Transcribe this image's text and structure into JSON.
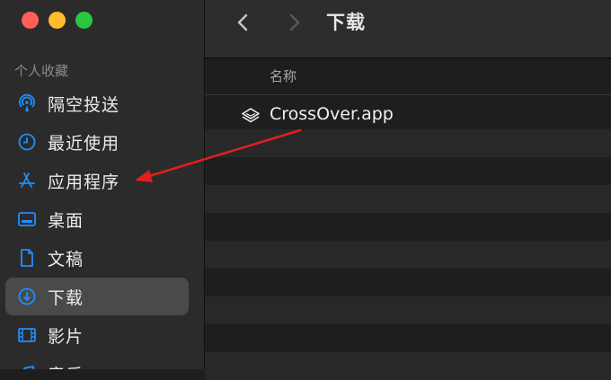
{
  "window": {
    "title": "下载"
  },
  "sidebar": {
    "section_label": "个人收藏",
    "items": [
      {
        "label": "隔空投送",
        "icon": "airdrop-icon"
      },
      {
        "label": "最近使用",
        "icon": "clock-icon"
      },
      {
        "label": "应用程序",
        "icon": "applications-icon"
      },
      {
        "label": "桌面",
        "icon": "desktop-icon"
      },
      {
        "label": "文稿",
        "icon": "document-icon"
      },
      {
        "label": "下载",
        "icon": "download-icon",
        "selected": true
      },
      {
        "label": "影片",
        "icon": "film-icon"
      },
      {
        "label": "音乐",
        "icon": "music-icon"
      }
    ]
  },
  "columns": {
    "name_header": "名称"
  },
  "files": [
    {
      "name": "CrossOver.app",
      "icon": "app-bundle-icon"
    }
  ],
  "colors": {
    "accent": "#1e90ff",
    "annotation_arrow": "#e0201e",
    "selected_bg": "#4a4a4a"
  }
}
